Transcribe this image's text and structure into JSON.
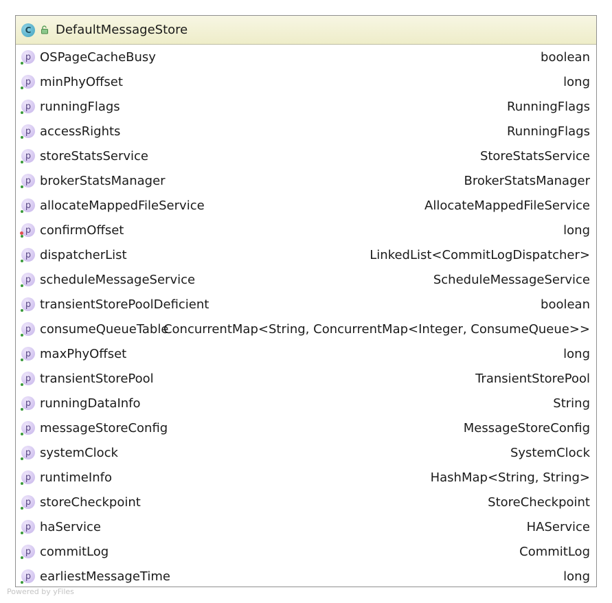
{
  "class": {
    "icon": "class-c-icon",
    "icon_letter": "C",
    "visibility_icon": "lock-open-icon",
    "name": "DefaultMessageStore",
    "header_color": "#eeedc9"
  },
  "field_icon": {
    "name": "property-p-icon",
    "letter": "p",
    "color": "#c5b3ea"
  },
  "fields": [
    {
      "name": "OSPageCacheBusy",
      "type": "boolean",
      "marker": "green"
    },
    {
      "name": "minPhyOffset",
      "type": "long",
      "marker": "green"
    },
    {
      "name": "runningFlags",
      "type": "RunningFlags",
      "marker": "green"
    },
    {
      "name": "accessRights",
      "type": "RunningFlags",
      "marker": "green"
    },
    {
      "name": "storeStatsService",
      "type": "StoreStatsService",
      "marker": "green"
    },
    {
      "name": "brokerStatsManager",
      "type": "BrokerStatsManager",
      "marker": "green"
    },
    {
      "name": "allocateMappedFileService",
      "type": "AllocateMappedFileService",
      "marker": "green"
    },
    {
      "name": "confirmOffset",
      "type": "long",
      "marker": "green-red"
    },
    {
      "name": "dispatcherList",
      "type": "LinkedList<CommitLogDispatcher>",
      "marker": "green"
    },
    {
      "name": "scheduleMessageService",
      "type": "ScheduleMessageService",
      "marker": "green"
    },
    {
      "name": "transientStorePoolDeficient",
      "type": "boolean",
      "marker": "green"
    },
    {
      "name": "consumeQueueTable",
      "type": "ConcurrentMap<String, ConcurrentMap<Integer, ConsumeQueue>>",
      "marker": "green"
    },
    {
      "name": "maxPhyOffset",
      "type": "long",
      "marker": "green"
    },
    {
      "name": "transientStorePool",
      "type": "TransientStorePool",
      "marker": "green"
    },
    {
      "name": "runningDataInfo",
      "type": "String",
      "marker": "green"
    },
    {
      "name": "messageStoreConfig",
      "type": "MessageStoreConfig",
      "marker": "green"
    },
    {
      "name": "systemClock",
      "type": "SystemClock",
      "marker": "green"
    },
    {
      "name": "runtimeInfo",
      "type": "HashMap<String, String>",
      "marker": "green"
    },
    {
      "name": "storeCheckpoint",
      "type": "StoreCheckpoint",
      "marker": "green"
    },
    {
      "name": "haService",
      "type": "HAService",
      "marker": "green"
    },
    {
      "name": "commitLog",
      "type": "CommitLog",
      "marker": "green"
    },
    {
      "name": "earliestMessageTime",
      "type": "long",
      "marker": "green"
    }
  ],
  "footer": {
    "watermark": "Powered by yFiles"
  }
}
